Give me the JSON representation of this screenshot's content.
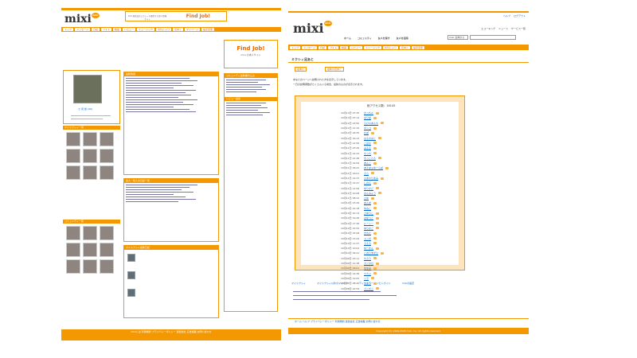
{
  "left": {
    "logo": "mixi",
    "logo_badge": "mixi",
    "ad_text": "Find Job!",
    "ad_sub": "mixi 株式会社ミクシィが運営する求人情報サイト",
    "nav": [
      "トップ",
      "メッセージ",
      "日記",
      "フォト",
      "動画",
      "レビュー",
      "ミュージック",
      "お気に入り",
      "足あと",
      "マイページ",
      "設定変更"
    ],
    "profile_name": "さ 見 俊 (40)",
    "sections": [
      "最新情報",
      "友人・知人の日記一覧",
      "マイミクシィ最新日記",
      "コミュニティ最新書き込み",
      "レビュー最新"
    ],
    "mymixi_header": "マイミクシィ一覧",
    "community_header": "コミュニティ一覧",
    "right_ad": "Find Job!",
    "right_ad_sub": "mixi の求人サイト",
    "footer": "mixiとは 利用規約 プライバシーポリシー 運営会社 広告掲載 お問い合わせ"
  },
  "right": {
    "logo": "mixi",
    "header_links": [
      "ヘルプ",
      "ログアウト"
    ],
    "top_links": [
      "エコーキング",
      "ニュース",
      "サービス一覧"
    ],
    "menu": [
      "ホーム",
      "コミュニティ",
      "友人を探す",
      "友人を招待"
    ],
    "search_value": "mixi 全体から",
    "nav": [
      "トップ",
      "メッセージ",
      "日記",
      "フォト",
      "動画",
      "レビュー",
      "ミュージック",
      "お気に入り",
      "足あと",
      "設定変更"
    ],
    "page_title": "ミクシィ足あと",
    "tabs": [
      "足あと",
      "最新の足あと"
    ],
    "notice1": "あなたのページへ訪問された方を表示しています。",
    "notice2": "一日の訪問者数がたくさんいる場合、最新のものが表示されます。",
    "total_label": "総アクセス数：",
    "total_value": "16145",
    "history": [
      {
        "date": "10月13日 07:35",
        "name": "きっちゃ"
      },
      {
        "date": "10月13日 07:14",
        "name": "なりぽ"
      },
      {
        "date": "10月12日 23:50",
        "name": "らぴゃあんち"
      },
      {
        "date": "10月12日 21:34",
        "name": "ギンコ"
      },
      {
        "date": "10月12日 18:35",
        "name": "かぽ"
      },
      {
        "date": "10月12日 16:12",
        "name": "はるのおと"
      },
      {
        "date": "10月12日 12:56",
        "name": "こばゃ"
      },
      {
        "date": "10月11日 23:49",
        "name": "みるる"
      },
      {
        "date": "10月11日 22:33",
        "name": "ちっち"
      },
      {
        "date": "10月11日 21:38",
        "name": "ちっこたろ"
      },
      {
        "date": "10月11日 19:09",
        "name": "あんこ"
      },
      {
        "date": "10月11日 18:41",
        "name": "あそぼぉゆーらぽ"
      },
      {
        "date": "10月11日 16:01",
        "name": "そら"
      },
      {
        "date": "10月11日 14:37",
        "name": "ひまわりまみ"
      },
      {
        "date": "10月11日 13:47",
        "name": "しのん"
      },
      {
        "date": "10月11日 11:59",
        "name": "ゆりかど"
      },
      {
        "date": "10月11日 10:08",
        "name": "おんみょう"
      },
      {
        "date": "10月11日 08:22",
        "name": "さゆ"
      },
      {
        "date": "10月10日 23:49",
        "name": "ぽんぽ"
      },
      {
        "date": "10月10日 22:18",
        "name": "ゆみこ"
      },
      {
        "date": "10月10日 20:13",
        "name": "さゆりこ"
      },
      {
        "date": "10月10日 19:48",
        "name": "はなっこ"
      },
      {
        "date": "10月10日 17:36",
        "name": "ルーシー"
      },
      {
        "date": "10月10日 15:55",
        "name": "ゆりかご"
      },
      {
        "date": "10月10日 15:08",
        "name": "きちた"
      },
      {
        "date": "10月10日 13:44",
        "name": "トンボ"
      },
      {
        "date": "10月10日 11:27",
        "name": "るるる"
      },
      {
        "date": "10月10日 10:02",
        "name": "ゆーかん"
      },
      {
        "date": "10月10日 09:21",
        "name": "とおりすがり"
      },
      {
        "date": "10月09日 23:11",
        "name": "ちろり"
      },
      {
        "date": "10月09日 21:38",
        "name": "カンタロ"
      },
      {
        "date": "10月09日 18:01",
        "name": "ななみ"
      },
      {
        "date": "10月09日 14:36",
        "name": "ワカメ"
      },
      {
        "date": "10月09日 12:05",
        "name": "ソラ"
      },
      {
        "date": "10月09日 08:40",
        "name": "りょう"
      },
      {
        "date": "10月08日 22:59",
        "name": "ペンギン"
      }
    ],
    "bottom_links": [
      "マイミクシィ",
      "マイミクシィ以外のマイミク",
      "ディスカバー ナツビトガイド",
      "mixiの設定"
    ],
    "footer1": "ホーム ヘルプ プライバシーポリシー 利用規約 運営会社 広告掲載 お問い合わせ",
    "footer2": "Copyright (C) 1999-2008 mixi, Inc. All rights reserved."
  },
  "colors": {
    "accent": "#f39800",
    "link": "#0066cc",
    "panel": "#fff7e6"
  }
}
